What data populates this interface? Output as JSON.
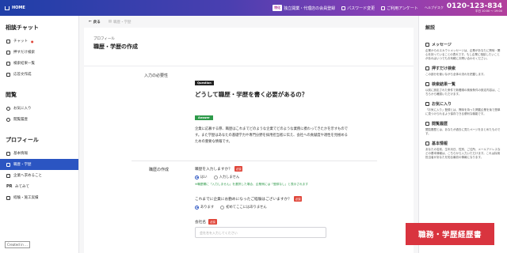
{
  "topbar": {
    "brand": "HOME",
    "tag": "特化",
    "job_change_label": "独立開業・代理店の会員登録",
    "password_label": "パスワード変更",
    "survey_label": "ご利用アンケート",
    "help_label": "ヘルプデスク",
    "phone": "0120-123-834",
    "hours": "平日 10:00 〜 19:00"
  },
  "sidebar": {
    "section_chat": "相談チャット",
    "chat_items": [
      {
        "label": "チャット",
        "badge": "●"
      },
      {
        "label": "押すだけ検索"
      },
      {
        "label": "検索結果一覧"
      },
      {
        "label": "応答文作成"
      }
    ],
    "section_view": "閲覧",
    "view_items": [
      {
        "label": "お気に入り"
      },
      {
        "label": "閲覧履歴"
      }
    ],
    "section_profile": "プロフィール",
    "profile_items": [
      {
        "label": "基本情報"
      },
      {
        "label": "職歴・学歴"
      },
      {
        "label": "企業へ求めること"
      },
      {
        "label": "PR"
      },
      {
        "label": "経験・施工実績"
      }
    ],
    "profile_pr_icon": "PR",
    "profile_pr_label": "みてみて",
    "credit": "Created in ..."
  },
  "crumb": {
    "back": "戻る",
    "current": "職歴・学歴"
  },
  "page": {
    "kicker": "プロフィール",
    "title": "職歴・学歴の作成"
  },
  "qa": {
    "label": "入力の必要性",
    "question_badge": "Question",
    "question": "どうして職歴・学歴を書く必要があるの？",
    "answer_badge": "Answer",
    "answer_lines": [
      "企業に応募する際、職歴はこれまでどのような企業でどのような業務に携わってきたかを示すもので",
      "す。また学歴はあなたの基礎学力や専門分野を採用担当者に伝え、会社への貢献度や適性を見極める",
      "ための重要な情報です。"
    ]
  },
  "form": {
    "label": "職歴の作成",
    "q1": "職歴を入力しますか？",
    "req": "必須",
    "q1_opt_yes": "はい",
    "q1_opt_no": "入力しません",
    "q1_note": "※職歴欄に「入力しません」を選択した場合、企業側には「登録なし」と表示されます",
    "q2": "これまでに企業にお勤めになったご経験はございますか？",
    "q2_opt_yes": "あります",
    "q2_opt_no": "初めてここにはありません",
    "company_label": "会社名",
    "company_placeholder": "会社名を入力してください"
  },
  "rpanel": {
    "title": "解説",
    "items": [
      {
        "head": "メッセージ",
        "body": "企業からのスカウトメッセージは、企業があなたに興味・関心を持っていることの表れです。もし企業に相談したいことがあればいつでもお気軽にお問い合わせください。"
      },
      {
        "head": "押すだけ検索",
        "body": "この部分を使いながら全体の流れを把握します。"
      },
      {
        "head": "検索結果一覧",
        "body": "以前に設定された条件で新着順の検索条件の設定内容は、こちらから確認いただけます。"
      },
      {
        "head": "お気に入り",
        "body": "「お気に入り」登録とは、興味を持った掲載企業を後で簡単に見つけられるよう保存できる便利な機能です。"
      },
      {
        "head": "閲覧履歴",
        "body": "閲覧履歴とは、あなたが過去に見たページをまとめたものです。"
      },
      {
        "head": "基本情報",
        "body": "あなたの名前、生年月日、性別、ご住所、メールアドレスなどの基本情報は、こちらから入力いただけます。これは採用担当者があなたを知る最初の情報になります。"
      }
    ]
  },
  "banner": "職務・学歴経歴書",
  "colors": {
    "accent_blue": "#2b55c2",
    "required_red": "#e0473b",
    "answer_green": "#2e9a4a",
    "banner_red": "#d9343f"
  }
}
